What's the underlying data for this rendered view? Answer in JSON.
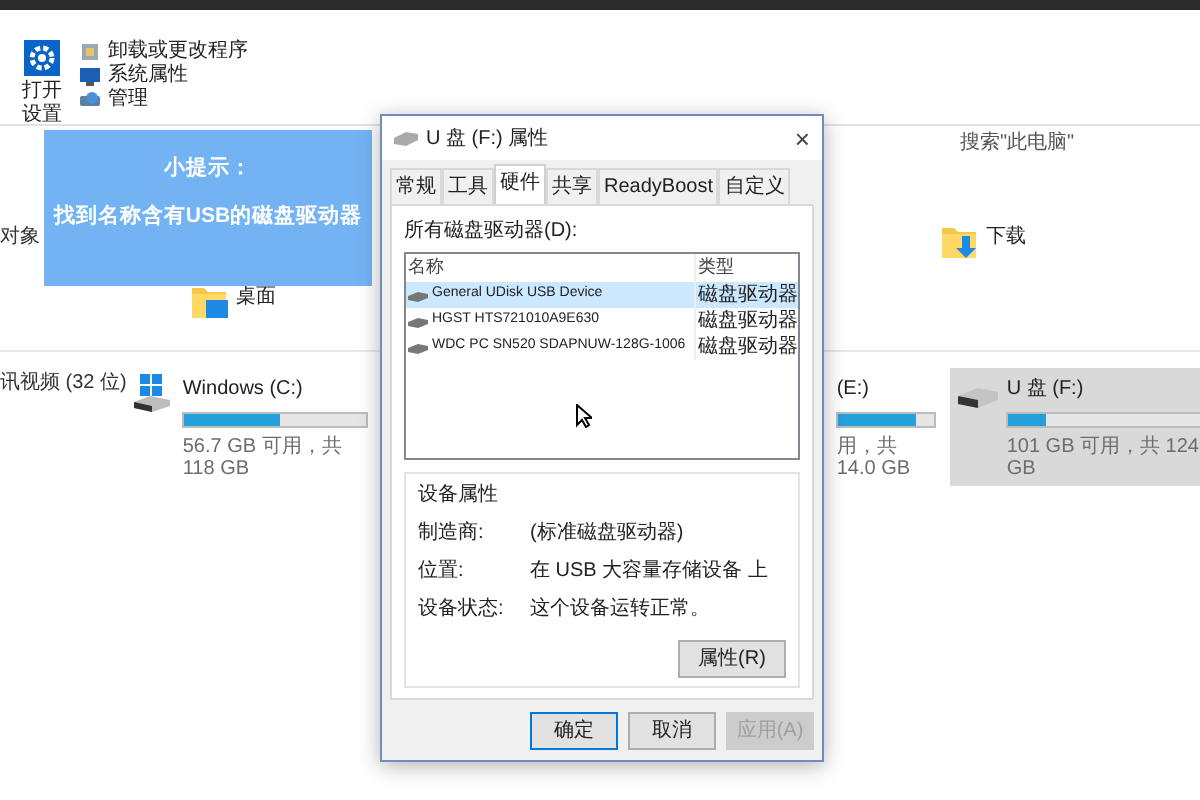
{
  "ribbon": {
    "settings_label": [
      "打开",
      "设置"
    ],
    "commands": [
      "卸载或更改程序",
      "系统属性",
      "管理"
    ]
  },
  "search": {
    "placeholder": "搜索\"此电脑\""
  },
  "side_labels": [
    "对象",
    "讯视频 (32 位)"
  ],
  "folders": [
    "下载",
    "桌面"
  ],
  "drives": [
    {
      "label": "Windows (C:)",
      "level": 0.52,
      "reading": "56.7 GB 可用，共 118 GB",
      "selected": false
    },
    {
      "label": "(E:)",
      "level": 0.8,
      "reading": "用，共 14.0 GB",
      "selected": false
    },
    {
      "label": "U 盘 (F:)",
      "level": 0.19,
      "reading": "101 GB 可用，共 124 GB",
      "selected": true
    }
  ],
  "tip": {
    "title": "小提示：",
    "text": "找到名称含有USB的磁盘驱动器"
  },
  "dialog": {
    "title": "U 盘 (F:) 属性",
    "close": "×",
    "tabs": [
      {
        "label": "常规",
        "selected": false
      },
      {
        "label": "工具",
        "selected": false
      },
      {
        "label": "硬件",
        "selected": true
      },
      {
        "label": "共享",
        "selected": false
      },
      {
        "label": "ReadyBoost",
        "selected": false
      },
      {
        "label": "自定义",
        "selected": false
      }
    ],
    "list_label": "所有磁盘驱动器(D):",
    "columns": [
      "名称",
      "类型"
    ],
    "rows": [
      {
        "name": "General UDisk USB Device",
        "type": "磁盘驱动器",
        "selected": true
      },
      {
        "name": "HGST HTS721010A9E630",
        "type": "磁盘驱动器",
        "selected": false
      },
      {
        "name": "WDC PC SN520 SDAPNUW-128G-1006",
        "type": "磁盘驱动器",
        "selected": false
      }
    ],
    "group_title": "设备属性",
    "properties": [
      {
        "label": "制造商:",
        "value": "(标准磁盘驱动器)"
      },
      {
        "label": "位置:",
        "value": "在 USB 大容量存储设备 上"
      },
      {
        "label": "设备状态:",
        "value": "这个设备运转正常。"
      }
    ],
    "properties_button": "属性(R)",
    "buttons": [
      {
        "label": "确定",
        "kind": "default",
        "disabled": false
      },
      {
        "label": "取消",
        "kind": "normal",
        "disabled": false
      },
      {
        "label": "应用(A)",
        "kind": "normal",
        "disabled": true
      }
    ]
  }
}
